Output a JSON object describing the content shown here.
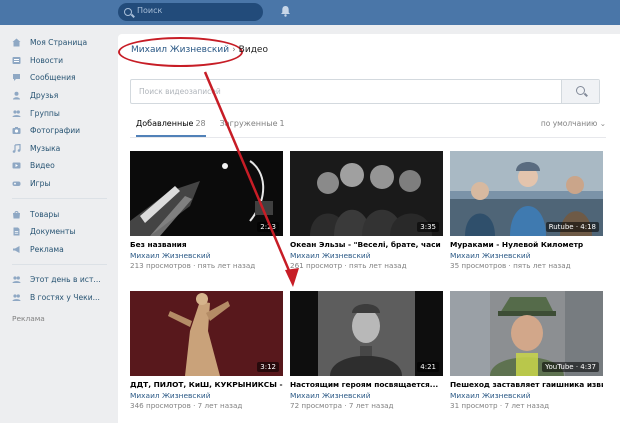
{
  "topbar": {
    "search_placeholder": "Поиск",
    "bell_icon": "bell-icon",
    "color": "#4a76a8"
  },
  "sidebar": {
    "items": [
      {
        "label": "Моя Страница",
        "icon": "home-icon"
      },
      {
        "label": "Новости",
        "icon": "news-icon"
      },
      {
        "label": "Сообщения",
        "icon": "chat-icon"
      },
      {
        "label": "Друзья",
        "icon": "user-icon"
      },
      {
        "label": "Группы",
        "icon": "group-icon"
      },
      {
        "label": "Фотографии",
        "icon": "camera-icon"
      },
      {
        "label": "Музыка",
        "icon": "music-icon"
      },
      {
        "label": "Видео",
        "icon": "video-icon"
      },
      {
        "label": "Игры",
        "icon": "gamepad-icon"
      }
    ],
    "items2": [
      {
        "label": "Товары",
        "icon": "shop-icon"
      },
      {
        "label": "Документы",
        "icon": "document-icon"
      },
      {
        "label": "Реклама",
        "icon": "megaphone-icon"
      }
    ],
    "items3": [
      {
        "label": "Этот день в ист...",
        "icon": "people-icon"
      },
      {
        "label": "В гостях у Чеки...",
        "icon": "people-icon"
      }
    ],
    "ads": "Реклама"
  },
  "main": {
    "owner": "Михаил Жизневский",
    "page": "Видео",
    "search_placeholder": "Поиск видеозаписей",
    "tabs": [
      {
        "label": "Добавленные",
        "count": "28"
      },
      {
        "label": "Загруженные",
        "count": "1"
      }
    ],
    "sort": "по умолчанию",
    "accent": "#5181b8",
    "annotation_color": "#c71d26"
  },
  "videos": [
    {
      "title": "Без названия",
      "author": "Михаил Жизневский",
      "meta": "213 просмотров · пять лет назад",
      "duration": "2:23"
    },
    {
      "title": "Океан Эльзы - \"Веселі, брате, часи наст...",
      "author": "Михаил Жизневский",
      "meta": "261 просмотр · пять лет назад",
      "duration": "3:35"
    },
    {
      "title": "Мураками - Нулевой Километр",
      "author": "Михаил Жизневский",
      "meta": "35 просмотров · пять лет назад",
      "duration": "Rutube · 4:18"
    },
    {
      "title": "ДДТ, ПИЛОТ, КиШ, КУКРЫНИКСЫ - \"Ро...",
      "author": "Михаил Жизневский",
      "meta": "346 просмотров · 7 лет назад",
      "duration": "3:12"
    },
    {
      "title": "Настоящим героям посвящается...",
      "author": "Михаил Жизневский",
      "meta": "72 просмотра · 7 лет назад",
      "duration": "4:21"
    },
    {
      "title": "Пешеход заставляет гаишника извинятся",
      "author": "Михаил Жизневский",
      "meta": "31 просмотр · 7 лет назад",
      "duration": "YouTube · 4:37"
    }
  ]
}
